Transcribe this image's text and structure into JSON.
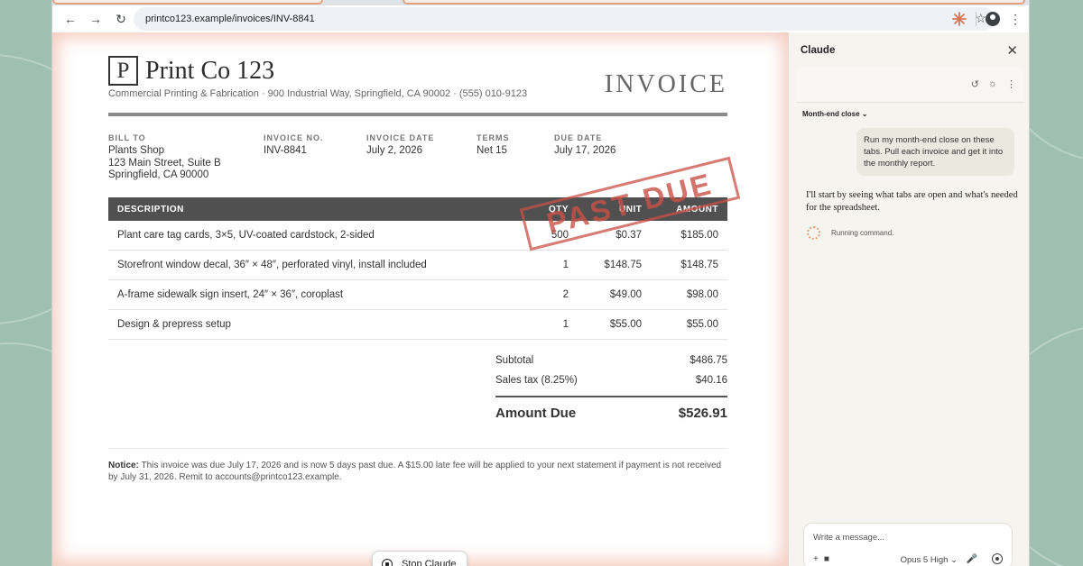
{
  "browser": {
    "url": "printco123.example/invoices/INV-8841"
  },
  "invoice": {
    "logo_letter": "P",
    "company_name": "Print Co 123",
    "company_line": "Commercial Printing & Fabrication · 900 Industrial Way, Springfield, CA 90002 · (555) 010-9123",
    "title": "INVOICE",
    "stamp": "PAST DUE",
    "bill_to_label": "BILL TO",
    "bill_to_lines": [
      "Plants Shop",
      "123 Main Street, Suite B",
      "Springfield, CA 90000"
    ],
    "invoice_no_label": "INVOICE NO.",
    "invoice_no": "INV-8841",
    "invoice_date_label": "INVOICE DATE",
    "invoice_date": "July 2, 2026",
    "terms_label": "TERMS",
    "terms": "Net 15",
    "due_date_label": "DUE DATE",
    "due_date": "July 17, 2026",
    "columns": [
      "DESCRIPTION",
      "QTY",
      "UNIT",
      "AMOUNT"
    ],
    "items": [
      {
        "description": "Plant care tag cards, 3×5, UV-coated cardstock, 2-sided",
        "qty": "500",
        "unit": "$0.37",
        "amount": "$185.00"
      },
      {
        "description": "Storefront window decal, 36″ × 48″, perforated vinyl, install included",
        "qty": "1",
        "unit": "$148.75",
        "amount": "$148.75"
      },
      {
        "description": "A-frame sidewalk sign insert, 24″ × 36″, coroplast",
        "qty": "2",
        "unit": "$49.00",
        "amount": "$98.00"
      },
      {
        "description": "Design & prepress setup",
        "qty": "1",
        "unit": "$55.00",
        "amount": "$55.00"
      }
    ],
    "subtotal_label": "Subtotal",
    "subtotal": "$486.75",
    "tax_label": "Sales tax (8.25%)",
    "tax": "$40.16",
    "amount_due_label": "Amount Due",
    "amount_due": "$526.91",
    "notice_label": "Notice:",
    "notice_text": "This invoice was due July 17, 2026 and is now 5 days past due. A $15.00 late fee will be applied to your next statement if payment is not received by July 31, 2026. Remit to accounts@printco123.example."
  },
  "stop_button": "Stop Claude",
  "panel": {
    "title": "Claude",
    "conversation_title": "Month-end close",
    "user_message": "Run my month-end close on these tabs. Pull each invoice and get it into the monthly report.",
    "assistant_message": "I'll start by seeing what tabs are open and what's needed for the spreadsheet.",
    "status": "Running command.",
    "input_placeholder": "Write a message...",
    "model": "Opus 5",
    "effort": "High"
  },
  "colors": {
    "accent": "#e3a27f",
    "stamp": "#c85046",
    "table_header": "#505050"
  }
}
